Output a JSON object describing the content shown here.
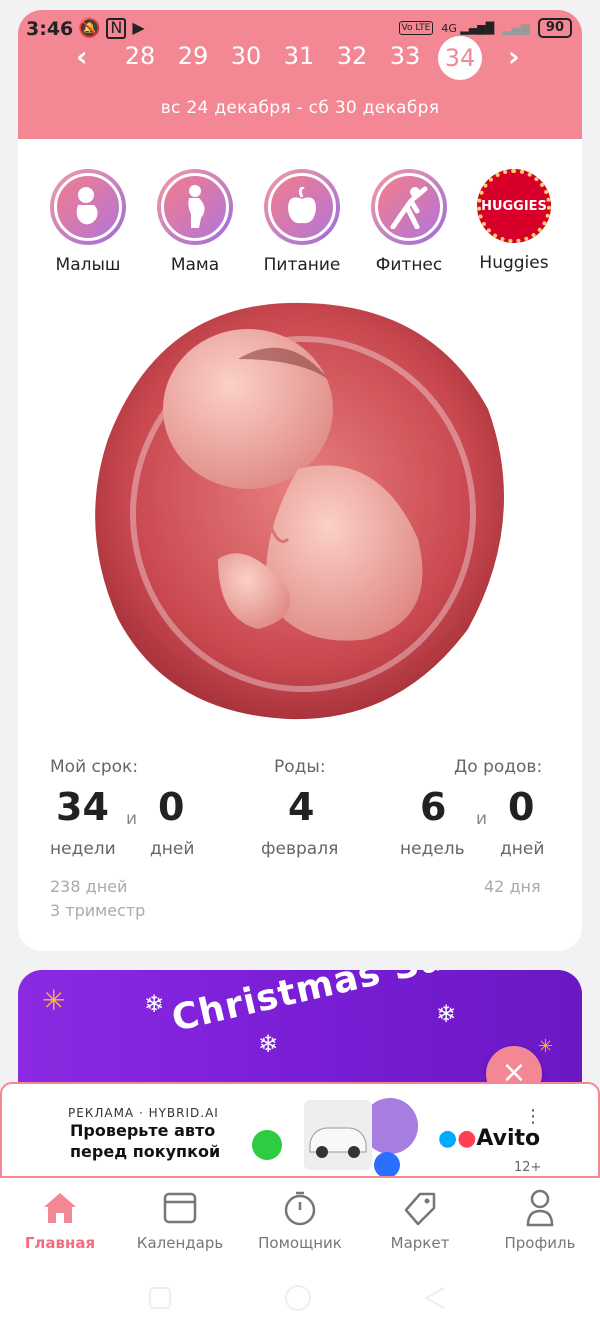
{
  "status": {
    "time": "3:46",
    "network": "4G",
    "volte": "Vo LTE",
    "battery": "90"
  },
  "weeks": {
    "items": [
      "28",
      "29",
      "30",
      "31",
      "32",
      "33",
      "34"
    ],
    "active": "34",
    "range": "вс 24 декабря - сб 30 декабря"
  },
  "categories": [
    {
      "label": "Малыш",
      "icon": "baby-icon"
    },
    {
      "label": "Мама",
      "icon": "pregnant-mother-icon"
    },
    {
      "label": "Питание",
      "icon": "apple-icon"
    },
    {
      "label": "Фитнес",
      "icon": "fitness-pose-icon"
    },
    {
      "label": "Huggies",
      "icon": "huggies-logo",
      "logo_text": "HUGGIES"
    }
  ],
  "stats": {
    "term": {
      "label": "Мой срок:",
      "weeks": "34",
      "and": "и",
      "days": "0",
      "weeks_unit": "недели",
      "days_unit": "дней"
    },
    "birth": {
      "label": "Роды:",
      "day": "4",
      "month": "февраля"
    },
    "remaining": {
      "label": "До родов:",
      "weeks": "6",
      "and": "и",
      "days": "0",
      "weeks_unit": "недель",
      "days_unit": "дней"
    },
    "total_days": "238 дней",
    "trimester": "3 триместр",
    "days_left": "42 дня"
  },
  "promo": {
    "title": "Christmas Sale"
  },
  "ad": {
    "tag": "РЕКЛАМА · HYBRID.AI",
    "line1": "Проверьте авто",
    "line2": "перед покупкой",
    "brand": "Avito",
    "age": "12+"
  },
  "nav": [
    {
      "label": "Главная",
      "active": true
    },
    {
      "label": "Календарь"
    },
    {
      "label": "Помощник"
    },
    {
      "label": "Маркет"
    },
    {
      "label": "Профиль"
    }
  ],
  "colors": {
    "accent": "#f38794",
    "active_nav": "#f06c7e",
    "promo": "#7a1ed6"
  }
}
